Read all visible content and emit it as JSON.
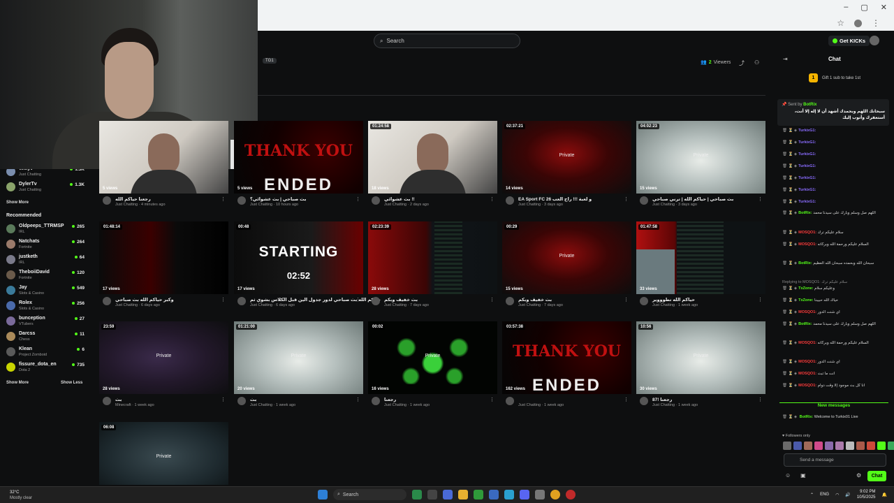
{
  "browser": {
    "bookmark_icon": "star-icon",
    "profile_icon": "avatar",
    "minimize": "–",
    "maximize": "▢",
    "close": "✕",
    "menu": "⋮"
  },
  "topbar": {
    "search_placeholder": "Search",
    "get_kicks_label": "Get KICKs"
  },
  "channel": {
    "tag": "TG1",
    "viewers_count": "2",
    "viewers_label": "Viewers"
  },
  "sidebar": {
    "following": [
      {
        "name": "Willyv",
        "category": "Just Chatting",
        "viewers": "1.5K",
        "color": "#7a8dad"
      },
      {
        "name": "DylerTv",
        "category": "Just Chatting",
        "viewers": "1.3K",
        "color": "#8aa36a"
      }
    ],
    "show_more_1": "Show More",
    "recommended_heading": "Recommended",
    "recommended": [
      {
        "name": "Oldpeeps_TTRMSP",
        "category": "IRL",
        "viewers": "265",
        "color": "#5a7a5a"
      },
      {
        "name": "Natchats",
        "category": "Fortnite",
        "viewers": "264",
        "color": "#9a7a6a"
      },
      {
        "name": "justketh",
        "category": "IRL",
        "viewers": "64",
        "color": "#7a7a8a"
      },
      {
        "name": "TheboiiDavid",
        "category": "Fortnite",
        "viewers": "120",
        "color": "#6a5a4a"
      },
      {
        "name": "Jay",
        "category": "Slots & Casino",
        "viewers": "549",
        "color": "#3a7a9a"
      },
      {
        "name": "Rolex",
        "category": "Slots & Casino",
        "viewers": "256",
        "color": "#4a6aaa"
      },
      {
        "name": "bunception",
        "category": "VTubers",
        "viewers": "27",
        "color": "#7a6a9a"
      },
      {
        "name": "Darcss",
        "category": "Chess",
        "viewers": "11",
        "color": "#aa8a5a"
      },
      {
        "name": "Klean",
        "category": "Project Zomboid",
        "viewers": "6",
        "color": "#5a5a5a"
      },
      {
        "name": "fissure_dota_en",
        "category": "Dota 2",
        "viewers": "735",
        "color": "#c8d400"
      }
    ],
    "show_more_2": "Show More",
    "show_less": "Show Less"
  },
  "videos": [
    {
      "duration": "",
      "views": "5 views",
      "title": "رجعنا حياكم الله",
      "category": "Just Chatting",
      "age": "4 minutes ago",
      "thumb": "cam",
      "private": ""
    },
    {
      "duration": "",
      "views": "5 views",
      "title": "بث صباحي | بث عشوائي؟",
      "category": "Just Chatting",
      "age": "10 hours ago",
      "thumb": "thankyou",
      "private": ""
    },
    {
      "duration": "01:24:58",
      "views": "18 views",
      "title": "بث عشوائي !!",
      "category": "Just Chatting",
      "age": "2 days ago",
      "thumb": "cam",
      "private": ""
    },
    {
      "duration": "02:37:21",
      "views": "14 views",
      "title": "EA Sport FC 26 و لعبة !!! راح العب",
      "category": "Just Chatting",
      "age": "3 days ago",
      "thumb": "red",
      "private": "Private"
    },
    {
      "duration": "04:02:23",
      "views": "15 views",
      "title": "بث صباحي | حياكم الله | ترني صباحي",
      "category": "Just Chatting",
      "age": "3 days ago",
      "thumb": "blur",
      "private": "Private"
    },
    {
      "duration": "01:48:14",
      "views": "17 views",
      "title": "وكبر حياكم الله بث صباحي",
      "category": "Just Chatting",
      "age": "6 days ago",
      "thumb": "dark",
      "private": ""
    },
    {
      "duration": "00:48",
      "views": "17 views",
      "title": "حياكم الله بث صباحي لدور جدول الين قبل الكلاس بشوي ثم",
      "category": "Just Chatting",
      "age": "6 days ago",
      "thumb": "starting",
      "private": ""
    },
    {
      "duration": "02:23:39",
      "views": "28 views",
      "title": "بث خفيف وبكم",
      "category": "Just Chatting",
      "age": "7 days ago",
      "thumb": "code",
      "private": ""
    },
    {
      "duration": "00:29",
      "views": "15 views",
      "title": "بث خفيف وبكم",
      "category": "Just Chatting",
      "age": "7 days ago",
      "thumb": "red",
      "private": "Private"
    },
    {
      "duration": "01:47:58",
      "views": "33 views",
      "title": "حياكم الله تطوووير",
      "category": "Just Chatting",
      "age": "1 week ago",
      "thumb": "code2",
      "private": ""
    },
    {
      "duration": "23:59",
      "views": "28 views",
      "title": "بث",
      "category": "Minecraft",
      "age": "1 week ago",
      "thumb": "purple",
      "private": "Private"
    },
    {
      "duration": "01:21:00",
      "views": "20 views",
      "title": "بث",
      "category": "Just Chatting",
      "age": "1 week ago",
      "thumb": "blur",
      "private": "Private"
    },
    {
      "duration": "00:02",
      "views": "16 views",
      "title": "رجعنا",
      "category": "Just Chatting",
      "age": "1 week ago",
      "thumb": "green",
      "private": "Private"
    },
    {
      "duration": "03:57:38",
      "views": "162 views",
      "title": "",
      "category": "Just Chatting",
      "age": "1 week ago",
      "thumb": "thankyou",
      "private": ""
    },
    {
      "duration": "10:56",
      "views": "30 views",
      "title": "رجعنا !87",
      "category": "Just Chatting",
      "age": "1 week ago",
      "thumb": "blur",
      "private": "Private"
    },
    {
      "duration": "06:08",
      "views": "",
      "title": "",
      "category": "",
      "age": "",
      "thumb": "blur2",
      "private": "Private"
    }
  ],
  "thumb_text": {
    "thank_you": "THANK YOU",
    "ended": "ENDED",
    "starting": "STARTING",
    "countdown": "02:52"
  },
  "chat": {
    "title": "Chat",
    "gift": "Gift 1 sub to take 1st",
    "pinned_by_label": "Sent by",
    "pinned_user": "BotRix",
    "pinned_message": "سبحانك اللهم وبحمدك أشهد أن لا إله إلا أنت، أستغفرك وأتوب إليك",
    "messages": [
      {
        "user": "TurkixG1:",
        "text": "",
        "color": "#8a6cff"
      },
      {
        "user": "TurkixG1:",
        "text": "",
        "color": "#8a6cff"
      },
      {
        "user": "TurkixG1:",
        "text": "",
        "color": "#8a6cff"
      },
      {
        "user": "TurkixG1:",
        "text": "",
        "color": "#8a6cff"
      },
      {
        "user": "TurkixG1:",
        "text": "",
        "color": "#8a6cff"
      },
      {
        "user": "TurkixG1:",
        "text": "",
        "color": "#8a6cff"
      },
      {
        "user": "TurkixG1:",
        "text": "",
        "color": "#8a6cff"
      },
      {
        "user": "BotRix:",
        "text": "اللهم صل وسلم وبارك على سيدنا محمد",
        "color": "#53fc18"
      },
      {
        "user": "MOSQO1:",
        "text": "سلام عليكم ترك",
        "color": "#ff3b3b"
      },
      {
        "user": "MOSQO1:",
        "text": "السلام عليكم ورحمة الله وبركاته",
        "color": "#ff3b3b"
      },
      {
        "user": "BotRix:",
        "text": "سبحان الله وبحمده سبحان الله العظيم",
        "color": "#53fc18"
      },
      {
        "user": "TxZone:",
        "text": "وعليكم سلام",
        "color": "#53fc18",
        "reply": "Replying to MOSQO1: سلام عليكم ترك"
      },
      {
        "user": "TxZone:",
        "text": "حياك الله حبيبنا",
        "color": "#53fc18"
      },
      {
        "user": "MOSQO1:",
        "text": "اي شنت الدور",
        "color": "#ff3b3b"
      },
      {
        "user": "BotRix:",
        "text": "اللهم صل وسلم وبارك على سيدنا محمد",
        "color": "#53fc18"
      },
      {
        "user": "MOSQO1:",
        "text": "السلام عليكم ورحمة الله وبركاته",
        "color": "#ff3b3b"
      },
      {
        "user": "MOSQO1:",
        "text": "اي شنت الدور",
        "color": "#ff3b3b"
      },
      {
        "user": "MOSQO1:",
        "text": "انت ما تبث",
        "color": "#ff3b3b"
      },
      {
        "user": "MOSQO1:",
        "text": "انا كل بث موجود إلا وقت دوام",
        "color": "#ff3b3b"
      }
    ],
    "new_messages": "New messages",
    "last_message": {
      "user": "BotRix:",
      "text": "Welcome to Turkix01 Live",
      "color": "#53fc18"
    },
    "followers_only": "Followers only",
    "send_placeholder": "Send a message",
    "send_button": "Chat"
  },
  "taskbar": {
    "temp": "32°C",
    "weather": "Mostly clear",
    "search": "Search",
    "lang": "ENG",
    "time": "9:02 PM",
    "date": "10/5/2025"
  }
}
